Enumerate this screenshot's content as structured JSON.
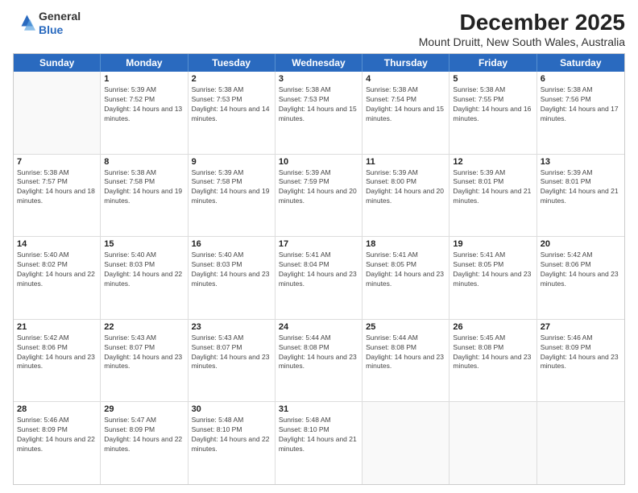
{
  "logo": {
    "line1": "General",
    "line2": "Blue"
  },
  "title": "December 2025",
  "location": "Mount Druitt, New South Wales, Australia",
  "weekdays": [
    "Sunday",
    "Monday",
    "Tuesday",
    "Wednesday",
    "Thursday",
    "Friday",
    "Saturday"
  ],
  "weeks": [
    [
      {
        "day": "",
        "sunrise": "",
        "sunset": "",
        "daylight": ""
      },
      {
        "day": "1",
        "sunrise": "Sunrise: 5:39 AM",
        "sunset": "Sunset: 7:52 PM",
        "daylight": "Daylight: 14 hours and 13 minutes."
      },
      {
        "day": "2",
        "sunrise": "Sunrise: 5:38 AM",
        "sunset": "Sunset: 7:53 PM",
        "daylight": "Daylight: 14 hours and 14 minutes."
      },
      {
        "day": "3",
        "sunrise": "Sunrise: 5:38 AM",
        "sunset": "Sunset: 7:53 PM",
        "daylight": "Daylight: 14 hours and 15 minutes."
      },
      {
        "day": "4",
        "sunrise": "Sunrise: 5:38 AM",
        "sunset": "Sunset: 7:54 PM",
        "daylight": "Daylight: 14 hours and 15 minutes."
      },
      {
        "day": "5",
        "sunrise": "Sunrise: 5:38 AM",
        "sunset": "Sunset: 7:55 PM",
        "daylight": "Daylight: 14 hours and 16 minutes."
      },
      {
        "day": "6",
        "sunrise": "Sunrise: 5:38 AM",
        "sunset": "Sunset: 7:56 PM",
        "daylight": "Daylight: 14 hours and 17 minutes."
      }
    ],
    [
      {
        "day": "7",
        "sunrise": "Sunrise: 5:38 AM",
        "sunset": "Sunset: 7:57 PM",
        "daylight": "Daylight: 14 hours and 18 minutes."
      },
      {
        "day": "8",
        "sunrise": "Sunrise: 5:38 AM",
        "sunset": "Sunset: 7:58 PM",
        "daylight": "Daylight: 14 hours and 19 minutes."
      },
      {
        "day": "9",
        "sunrise": "Sunrise: 5:39 AM",
        "sunset": "Sunset: 7:58 PM",
        "daylight": "Daylight: 14 hours and 19 minutes."
      },
      {
        "day": "10",
        "sunrise": "Sunrise: 5:39 AM",
        "sunset": "Sunset: 7:59 PM",
        "daylight": "Daylight: 14 hours and 20 minutes."
      },
      {
        "day": "11",
        "sunrise": "Sunrise: 5:39 AM",
        "sunset": "Sunset: 8:00 PM",
        "daylight": "Daylight: 14 hours and 20 minutes."
      },
      {
        "day": "12",
        "sunrise": "Sunrise: 5:39 AM",
        "sunset": "Sunset: 8:01 PM",
        "daylight": "Daylight: 14 hours and 21 minutes."
      },
      {
        "day": "13",
        "sunrise": "Sunrise: 5:39 AM",
        "sunset": "Sunset: 8:01 PM",
        "daylight": "Daylight: 14 hours and 21 minutes."
      }
    ],
    [
      {
        "day": "14",
        "sunrise": "Sunrise: 5:40 AM",
        "sunset": "Sunset: 8:02 PM",
        "daylight": "Daylight: 14 hours and 22 minutes."
      },
      {
        "day": "15",
        "sunrise": "Sunrise: 5:40 AM",
        "sunset": "Sunset: 8:03 PM",
        "daylight": "Daylight: 14 hours and 22 minutes."
      },
      {
        "day": "16",
        "sunrise": "Sunrise: 5:40 AM",
        "sunset": "Sunset: 8:03 PM",
        "daylight": "Daylight: 14 hours and 23 minutes."
      },
      {
        "day": "17",
        "sunrise": "Sunrise: 5:41 AM",
        "sunset": "Sunset: 8:04 PM",
        "daylight": "Daylight: 14 hours and 23 minutes."
      },
      {
        "day": "18",
        "sunrise": "Sunrise: 5:41 AM",
        "sunset": "Sunset: 8:05 PM",
        "daylight": "Daylight: 14 hours and 23 minutes."
      },
      {
        "day": "19",
        "sunrise": "Sunrise: 5:41 AM",
        "sunset": "Sunset: 8:05 PM",
        "daylight": "Daylight: 14 hours and 23 minutes."
      },
      {
        "day": "20",
        "sunrise": "Sunrise: 5:42 AM",
        "sunset": "Sunset: 8:06 PM",
        "daylight": "Daylight: 14 hours and 23 minutes."
      }
    ],
    [
      {
        "day": "21",
        "sunrise": "Sunrise: 5:42 AM",
        "sunset": "Sunset: 8:06 PM",
        "daylight": "Daylight: 14 hours and 23 minutes."
      },
      {
        "day": "22",
        "sunrise": "Sunrise: 5:43 AM",
        "sunset": "Sunset: 8:07 PM",
        "daylight": "Daylight: 14 hours and 23 minutes."
      },
      {
        "day": "23",
        "sunrise": "Sunrise: 5:43 AM",
        "sunset": "Sunset: 8:07 PM",
        "daylight": "Daylight: 14 hours and 23 minutes."
      },
      {
        "day": "24",
        "sunrise": "Sunrise: 5:44 AM",
        "sunset": "Sunset: 8:08 PM",
        "daylight": "Daylight: 14 hours and 23 minutes."
      },
      {
        "day": "25",
        "sunrise": "Sunrise: 5:44 AM",
        "sunset": "Sunset: 8:08 PM",
        "daylight": "Daylight: 14 hours and 23 minutes."
      },
      {
        "day": "26",
        "sunrise": "Sunrise: 5:45 AM",
        "sunset": "Sunset: 8:08 PM",
        "daylight": "Daylight: 14 hours and 23 minutes."
      },
      {
        "day": "27",
        "sunrise": "Sunrise: 5:46 AM",
        "sunset": "Sunset: 8:09 PM",
        "daylight": "Daylight: 14 hours and 23 minutes."
      }
    ],
    [
      {
        "day": "28",
        "sunrise": "Sunrise: 5:46 AM",
        "sunset": "Sunset: 8:09 PM",
        "daylight": "Daylight: 14 hours and 22 minutes."
      },
      {
        "day": "29",
        "sunrise": "Sunrise: 5:47 AM",
        "sunset": "Sunset: 8:09 PM",
        "daylight": "Daylight: 14 hours and 22 minutes."
      },
      {
        "day": "30",
        "sunrise": "Sunrise: 5:48 AM",
        "sunset": "Sunset: 8:10 PM",
        "daylight": "Daylight: 14 hours and 22 minutes."
      },
      {
        "day": "31",
        "sunrise": "Sunrise: 5:48 AM",
        "sunset": "Sunset: 8:10 PM",
        "daylight": "Daylight: 14 hours and 21 minutes."
      },
      {
        "day": "",
        "sunrise": "",
        "sunset": "",
        "daylight": ""
      },
      {
        "day": "",
        "sunrise": "",
        "sunset": "",
        "daylight": ""
      },
      {
        "day": "",
        "sunrise": "",
        "sunset": "",
        "daylight": ""
      }
    ]
  ]
}
